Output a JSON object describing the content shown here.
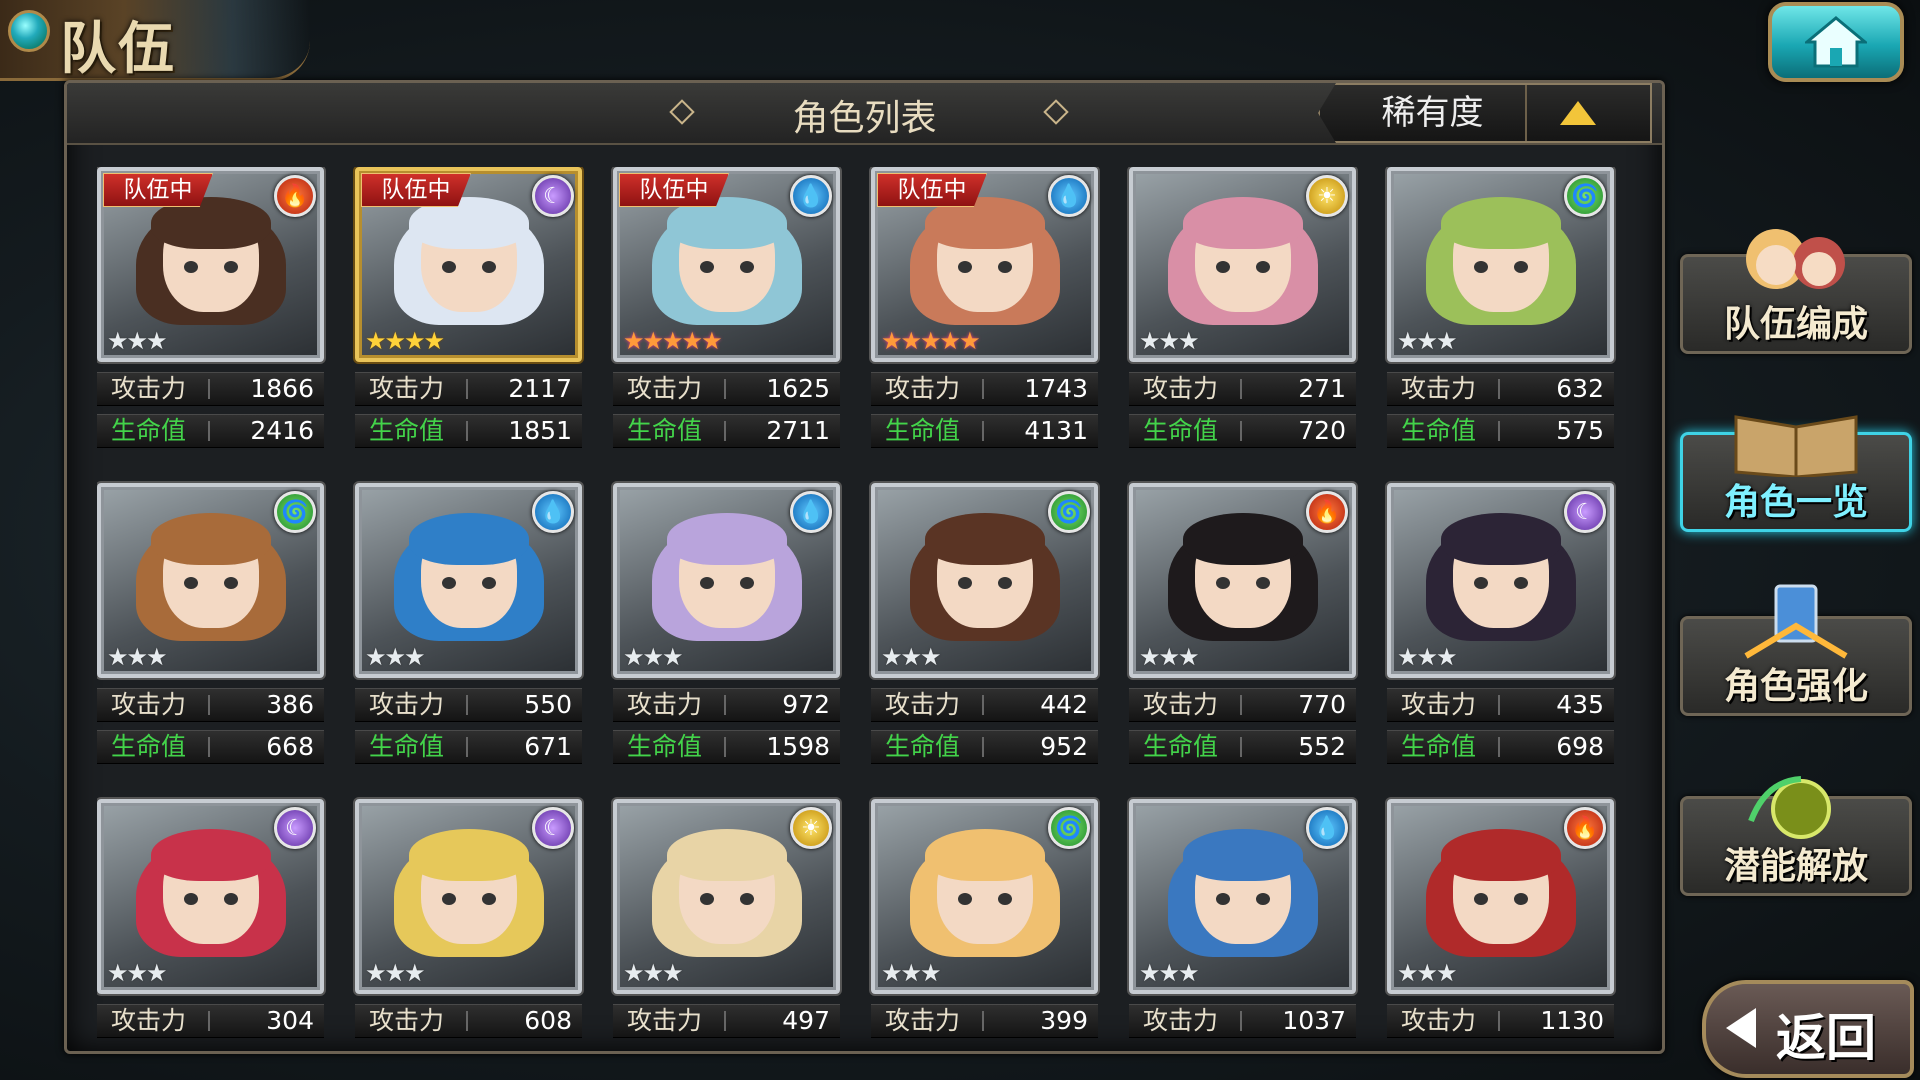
{
  "title": "队伍",
  "panel": {
    "title": "角色列表",
    "sort_label": "稀有度"
  },
  "labels": {
    "atk": "攻击力",
    "hp": "生命值",
    "party": "队伍中"
  },
  "side_menu": [
    {
      "label": "队伍编成",
      "active": false
    },
    {
      "label": "角色一览",
      "active": true
    },
    {
      "label": "角色强化",
      "active": false
    },
    {
      "label": "潜能解放",
      "active": false
    }
  ],
  "return_label": "返回",
  "characters": [
    {
      "in_party": true,
      "element": "fire",
      "stars": 3,
      "frame": "silver",
      "atk": "1866",
      "hp": "2416",
      "hair": "#4a2f22"
    },
    {
      "in_party": true,
      "element": "dark",
      "stars": 4,
      "frame": "gold",
      "atk": "2117",
      "hp": "1851",
      "hair": "#dde6f2"
    },
    {
      "in_party": true,
      "element": "water",
      "stars": 5,
      "frame": "silver",
      "atk": "1625",
      "hp": "2711",
      "hair": "#8fc6d6"
    },
    {
      "in_party": true,
      "element": "water",
      "stars": 5,
      "frame": "silver",
      "atk": "1743",
      "hp": "4131",
      "hair": "#c97a5a"
    },
    {
      "in_party": false,
      "element": "light",
      "stars": 3,
      "frame": "silver",
      "atk": "271",
      "hp": "720",
      "hair": "#d98fa6"
    },
    {
      "in_party": false,
      "element": "wind",
      "stars": 3,
      "frame": "silver",
      "atk": "632",
      "hp": "575",
      "hair": "#9cc05a"
    },
    {
      "in_party": false,
      "element": "wind",
      "stars": 3,
      "frame": "silver",
      "atk": "386",
      "hp": "668",
      "hair": "#a86b3a"
    },
    {
      "in_party": false,
      "element": "water",
      "stars": 3,
      "frame": "silver",
      "atk": "550",
      "hp": "671",
      "hair": "#2f7fc8"
    },
    {
      "in_party": false,
      "element": "water",
      "stars": 3,
      "frame": "silver",
      "atk": "972",
      "hp": "1598",
      "hair": "#b9a4dc"
    },
    {
      "in_party": false,
      "element": "wind",
      "stars": 3,
      "frame": "silver",
      "atk": "442",
      "hp": "952",
      "hair": "#5a3424"
    },
    {
      "in_party": false,
      "element": "fire",
      "stars": 3,
      "frame": "silver",
      "atk": "770",
      "hp": "552",
      "hair": "#1e1a1c"
    },
    {
      "in_party": false,
      "element": "dark",
      "stars": 3,
      "frame": "silver",
      "atk": "435",
      "hp": "698",
      "hair": "#2c2436"
    },
    {
      "in_party": false,
      "element": "dark",
      "stars": 3,
      "frame": "silver",
      "atk": "304",
      "hp": "",
      "hair": "#c8324a"
    },
    {
      "in_party": false,
      "element": "dark",
      "stars": 3,
      "frame": "silver",
      "atk": "608",
      "hp": "",
      "hair": "#e6c85a"
    },
    {
      "in_party": false,
      "element": "light",
      "stars": 3,
      "frame": "silver",
      "atk": "497",
      "hp": "",
      "hair": "#e8d4a6"
    },
    {
      "in_party": false,
      "element": "wind",
      "stars": 3,
      "frame": "silver",
      "atk": "399",
      "hp": "",
      "hair": "#f0c070"
    },
    {
      "in_party": false,
      "element": "water",
      "stars": 3,
      "frame": "silver",
      "atk": "1037",
      "hp": "",
      "hair": "#3a78c0"
    },
    {
      "in_party": false,
      "element": "fire",
      "stars": 3,
      "frame": "silver",
      "atk": "1130",
      "hp": "",
      "hair": "#b02a2a"
    }
  ]
}
